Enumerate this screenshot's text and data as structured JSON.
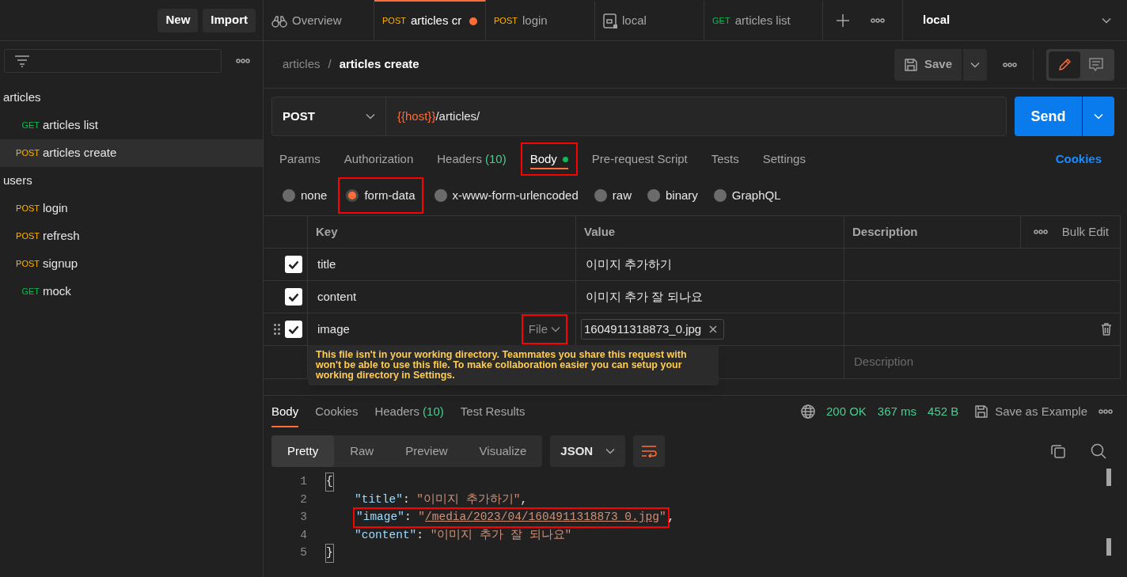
{
  "sidebar": {
    "buttons": [
      "New",
      "Import"
    ],
    "folders": [
      {
        "name": "articles",
        "children": [
          {
            "method": "GET",
            "name": "articles list",
            "selected": false
          },
          {
            "method": "POST",
            "name": "articles create",
            "selected": true
          }
        ]
      },
      {
        "name": "users",
        "children": [
          {
            "method": "POST",
            "name": "login",
            "selected": false
          },
          {
            "method": "POST",
            "name": "refresh",
            "selected": false
          },
          {
            "method": "POST",
            "name": "signup",
            "selected": false
          },
          {
            "method": "GET",
            "name": "mock",
            "selected": false
          }
        ]
      }
    ]
  },
  "tabs": [
    {
      "kind": "overview",
      "label": "Overview",
      "selected": false
    },
    {
      "kind": "request",
      "method": "POST",
      "label": "articles cr",
      "selected": true,
      "unsaved": true
    },
    {
      "kind": "request",
      "method": "POST",
      "label": "login",
      "selected": false,
      "unsaved": false
    },
    {
      "kind": "environment",
      "label": "local",
      "selected": false
    },
    {
      "kind": "request",
      "method": "GET",
      "label": "articles list",
      "selected": false,
      "unsaved": false
    }
  ],
  "environment": "local",
  "breadcrumb": [
    "articles",
    "articles create"
  ],
  "breadcrumb_separator": "/",
  "view_toggle": [
    {
      "kind": "edit",
      "selected": true
    },
    {
      "kind": "comments",
      "selected": false
    }
  ],
  "save_button": "Save",
  "request": {
    "method": "POST",
    "url": [
      {
        "kind": "variable",
        "text": "{{host}}"
      },
      {
        "kind": "plain",
        "text": "/articles/"
      }
    ],
    "send_button": "Send"
  },
  "request_tabs": [
    {
      "label": "Params",
      "selected": false,
      "highlighted": false
    },
    {
      "label": "Authorization",
      "selected": false,
      "highlighted": false
    },
    {
      "label": "Headers",
      "count": "(10)",
      "selected": false,
      "highlighted": false
    },
    {
      "label": "Body",
      "selected": true,
      "has_content": true,
      "highlighted": true
    },
    {
      "label": "Pre-request Script",
      "selected": false,
      "highlighted": false
    },
    {
      "label": "Tests",
      "selected": false,
      "highlighted": false
    },
    {
      "label": "Settings",
      "selected": false,
      "highlighted": false
    }
  ],
  "cookies_link": "Cookies",
  "body_types": [
    {
      "label": "none",
      "selected": false,
      "highlighted": false
    },
    {
      "label": "form-data",
      "selected": true,
      "highlighted": true
    },
    {
      "label": "x-www-form-urlencoded",
      "selected": false,
      "highlighted": false
    },
    {
      "label": "raw",
      "selected": false,
      "highlighted": false
    },
    {
      "label": "binary",
      "selected": false,
      "highlighted": false
    },
    {
      "label": "GraphQL",
      "selected": false,
      "highlighted": false
    }
  ],
  "table": {
    "columns": [
      "Key",
      "Value",
      "Description"
    ],
    "bulk_edit": "Bulk Edit",
    "rows": [
      {
        "kind": "text",
        "checked": true,
        "key": "title",
        "value": "이미지 추가하기"
      },
      {
        "kind": "text",
        "checked": true,
        "key": "content",
        "value": "이미지 추가 잘 되나요"
      },
      {
        "kind": "file",
        "checked": true,
        "key": "image",
        "type": "File",
        "type_highlighted": true,
        "value": "1604911318873_0.jpg",
        "hovered": true
      }
    ],
    "new_row": {
      "placeholder": "Description"
    },
    "tooltip": "This file isn't in your working directory. Teammates you share this request with won't be able to use this file. To make collaboration easier you can setup your working directory in Settings."
  },
  "response": {
    "tabs": [
      {
        "label": "Body",
        "selected": true
      },
      {
        "label": "Cookies",
        "selected": false
      },
      {
        "label": "Headers",
        "count": "(10)",
        "selected": false
      },
      {
        "label": "Test Results",
        "selected": false
      }
    ],
    "status": "200 OK",
    "time": "367 ms",
    "size": "452 B",
    "save_example": "Save as Example",
    "view_modes": [
      {
        "label": "Pretty",
        "selected": true
      },
      {
        "label": "Raw",
        "selected": false
      },
      {
        "label": "Preview",
        "selected": false
      },
      {
        "label": "Visualize",
        "selected": false
      }
    ],
    "format": "JSON",
    "lines": [
      {
        "number": "1",
        "tokens": [
          {
            "kind": "brace",
            "text": "{"
          }
        ]
      },
      {
        "number": "2",
        "tokens": [
          {
            "kind": "key",
            "text": "\"title\""
          },
          {
            "kind": "punct",
            "text": ": "
          },
          {
            "kind": "string",
            "text": "\"이미지 추가하기\""
          },
          {
            "kind": "punct",
            "text": ","
          }
        ]
      },
      {
        "number": "3",
        "tokens": [
          {
            "kind": "key",
            "text": "\"image\"",
            "highlighted": true
          },
          {
            "kind": "punct",
            "text": ": ",
            "highlighted": true
          },
          {
            "kind": "string",
            "text": "\"",
            "highlighted": true
          },
          {
            "kind": "link",
            "text": "/media/2023/04/1604911318873_0.jpg",
            "highlighted": true
          },
          {
            "kind": "string",
            "text": "\"",
            "highlighted": true
          },
          {
            "kind": "punct",
            "text": ","
          }
        ]
      },
      {
        "number": "4",
        "tokens": [
          {
            "kind": "key",
            "text": "\"content\""
          },
          {
            "kind": "punct",
            "text": ": "
          },
          {
            "kind": "string",
            "text": "\"이미지 추가 잘 되나요\""
          }
        ]
      },
      {
        "number": "5",
        "tokens": [
          {
            "kind": "brace",
            "text": "}"
          }
        ]
      }
    ]
  }
}
